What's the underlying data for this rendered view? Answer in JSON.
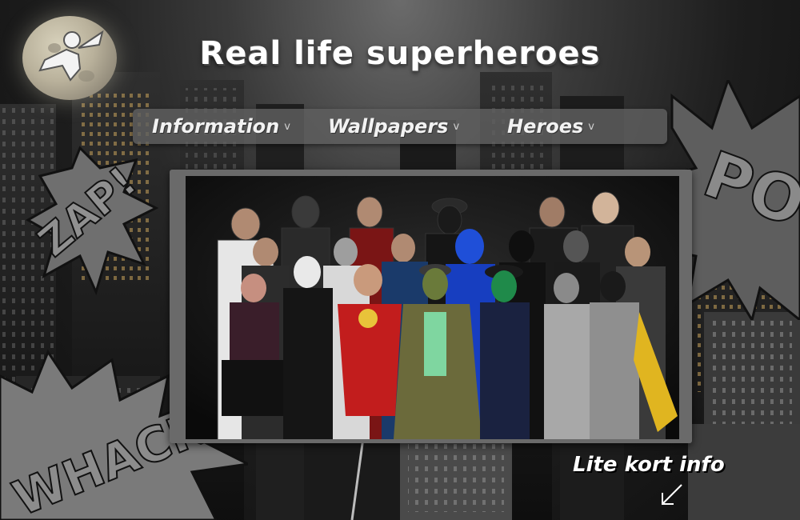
{
  "site": {
    "title": "Real life superheroes"
  },
  "nav": {
    "items": [
      {
        "label": "Information",
        "chevron": "v"
      },
      {
        "label": "Wallpapers",
        "chevron": "v"
      },
      {
        "label": "Heroes",
        "chevron": "v"
      }
    ]
  },
  "comic_words": {
    "zap": "ZAP!",
    "whack": "WHACK.",
    "pow": "PO"
  },
  "note": {
    "text": "Lite kort info"
  },
  "icons": {
    "moon": "moon-logo-icon",
    "hero": "flying-hero-icon",
    "arrow": "arrow-down-left-icon",
    "chevron": "chevron-down-icon"
  },
  "colors": {
    "nav_bg": "#5f5f5f",
    "panel_bg": "#6a6a6a",
    "title": "#ffffff"
  }
}
